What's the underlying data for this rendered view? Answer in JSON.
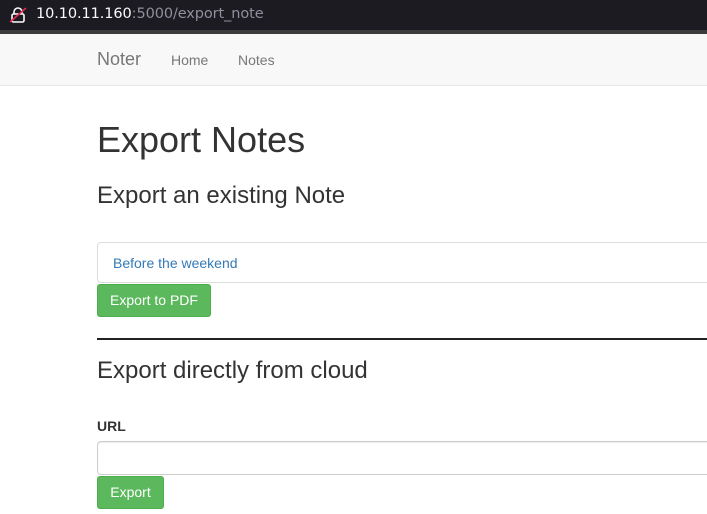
{
  "browser": {
    "url_host": "10.10.11.160",
    "url_rest": ":5000/export_note",
    "icons": {
      "security": "lock-icon"
    }
  },
  "navbar": {
    "brand": "Noter",
    "links": [
      {
        "label": "Home"
      },
      {
        "label": "Notes"
      }
    ]
  },
  "main": {
    "title": "Export Notes",
    "existing": {
      "heading": "Export an existing Note",
      "selected_note": "Before the weekend",
      "button_label": "Export to PDF"
    },
    "cloud": {
      "heading": "Export directly from cloud",
      "url_label": "URL",
      "url_value": "",
      "button_label": "Export"
    }
  },
  "colors": {
    "button_success": "#5cb85c",
    "link": "#337ab7",
    "navbar_bg": "#f8f8f8",
    "addressbar_bg": "#1c1b22"
  }
}
